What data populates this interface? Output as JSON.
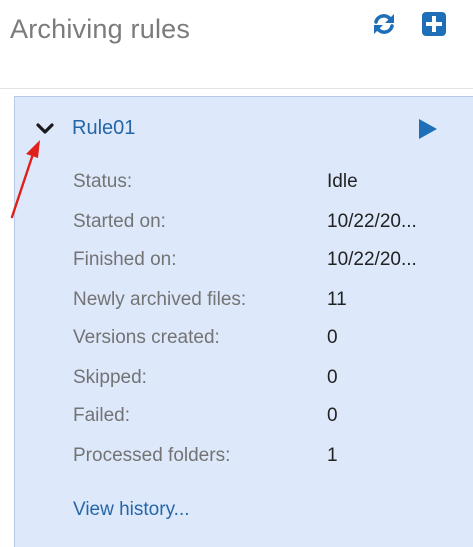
{
  "header": {
    "title": "Archiving rules",
    "refresh_icon": "refresh-icon",
    "add_icon": "add-icon"
  },
  "rule": {
    "name": "Rule01",
    "collapse_icon": "chevron-down-icon",
    "run_icon": "play-icon",
    "fields": [
      {
        "label": "Status:",
        "value": "Idle"
      },
      {
        "label": "Started on:",
        "value": "10/22/20..."
      },
      {
        "label": "Finished on:",
        "value": "10/22/20..."
      },
      {
        "label": "Newly archived files:",
        "value": "11"
      },
      {
        "label": "Versions created:",
        "value": "0"
      },
      {
        "label": "Skipped:",
        "value": "0"
      },
      {
        "label": "Failed:",
        "value": "0"
      },
      {
        "label": "Processed folders:",
        "value": "1"
      }
    ],
    "history_link": "View history..."
  },
  "colors": {
    "accent": "#2566a8",
    "card_background": "#dde9fb",
    "annotation": "#e0201b"
  }
}
